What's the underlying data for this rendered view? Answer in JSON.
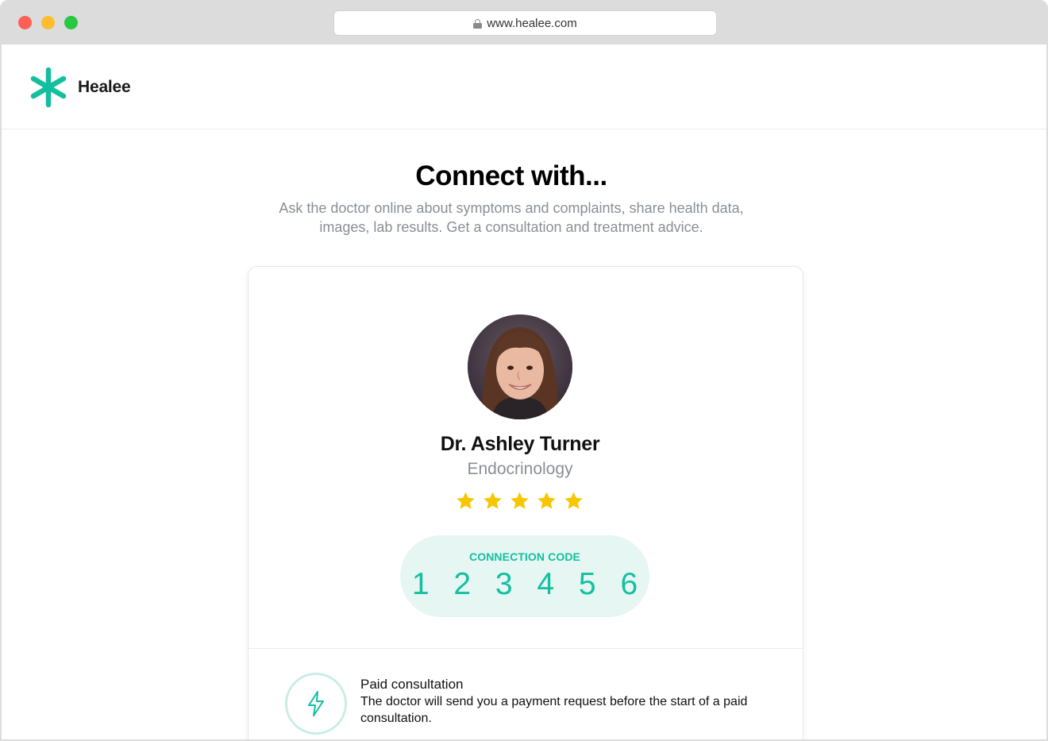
{
  "browser": {
    "url": "www.healee.com"
  },
  "header": {
    "brand": "Healee",
    "brand_color": "#14bfa0"
  },
  "main": {
    "title": "Connect with...",
    "subtitle": "Ask the doctor online about symptoms and complaints, share health data, images, lab results. Get a consultation and treatment advice."
  },
  "doctor": {
    "name": "Dr. Ashley Turner",
    "specialty": "Endocrinology",
    "rating": 5,
    "rating_max": 5,
    "star_color": "#f7c600"
  },
  "connection": {
    "label": "CONNECTION CODE",
    "code": "1 2 3 4 5 6"
  },
  "consultation": {
    "icon": "lightning-icon",
    "title": "Paid consultation",
    "description": "The doctor will send you a payment request before the start of a paid consultation."
  }
}
